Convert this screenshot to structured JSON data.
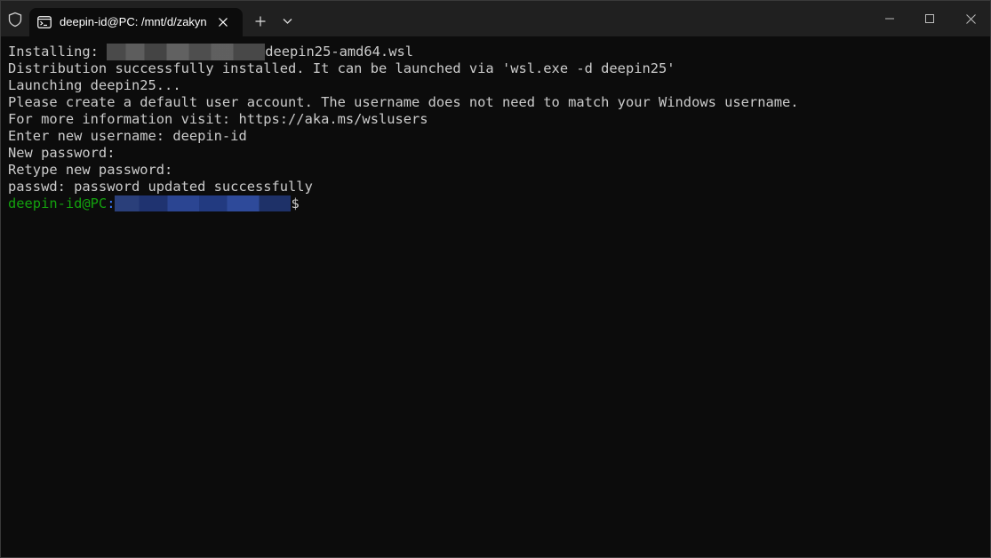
{
  "titlebar": {
    "tab_title": "deepin-id@PC: /mnt/d/zakyn",
    "shield_icon": "shield-icon",
    "tab_icon": "terminal-icon",
    "new_tab_symbol": "+",
    "dropdown_icon": "chevron-down-icon"
  },
  "window_controls": {
    "minimize_icon": "minimize-icon",
    "maximize_icon": "maximize-icon",
    "close_icon": "close-icon"
  },
  "terminal": {
    "line1_prefix": "Installing: ",
    "line1_suffix": "deepin25-amd64.wsl",
    "line2": "Distribution successfully installed. It can be launched via 'wsl.exe -d deepin25'",
    "line3": "Launching deepin25...",
    "line4": "Please create a default user account. The username does not need to match your Windows username.",
    "line5": "For more information visit: https://aka.ms/wslusers",
    "line6": "Enter new username: deepin-id",
    "line7": "New password:",
    "line8": "Retype new password:",
    "line9": "passwd: password updated successfully",
    "prompt_user": "deepin-id@PC",
    "prompt_colon": ":",
    "prompt_dollar": "$"
  },
  "colors": {
    "background": "#0c0c0c",
    "titlebar": "#202020",
    "text": "#cccccc",
    "prompt_user": "#13a10e",
    "prompt_path": "#3b78ff"
  }
}
